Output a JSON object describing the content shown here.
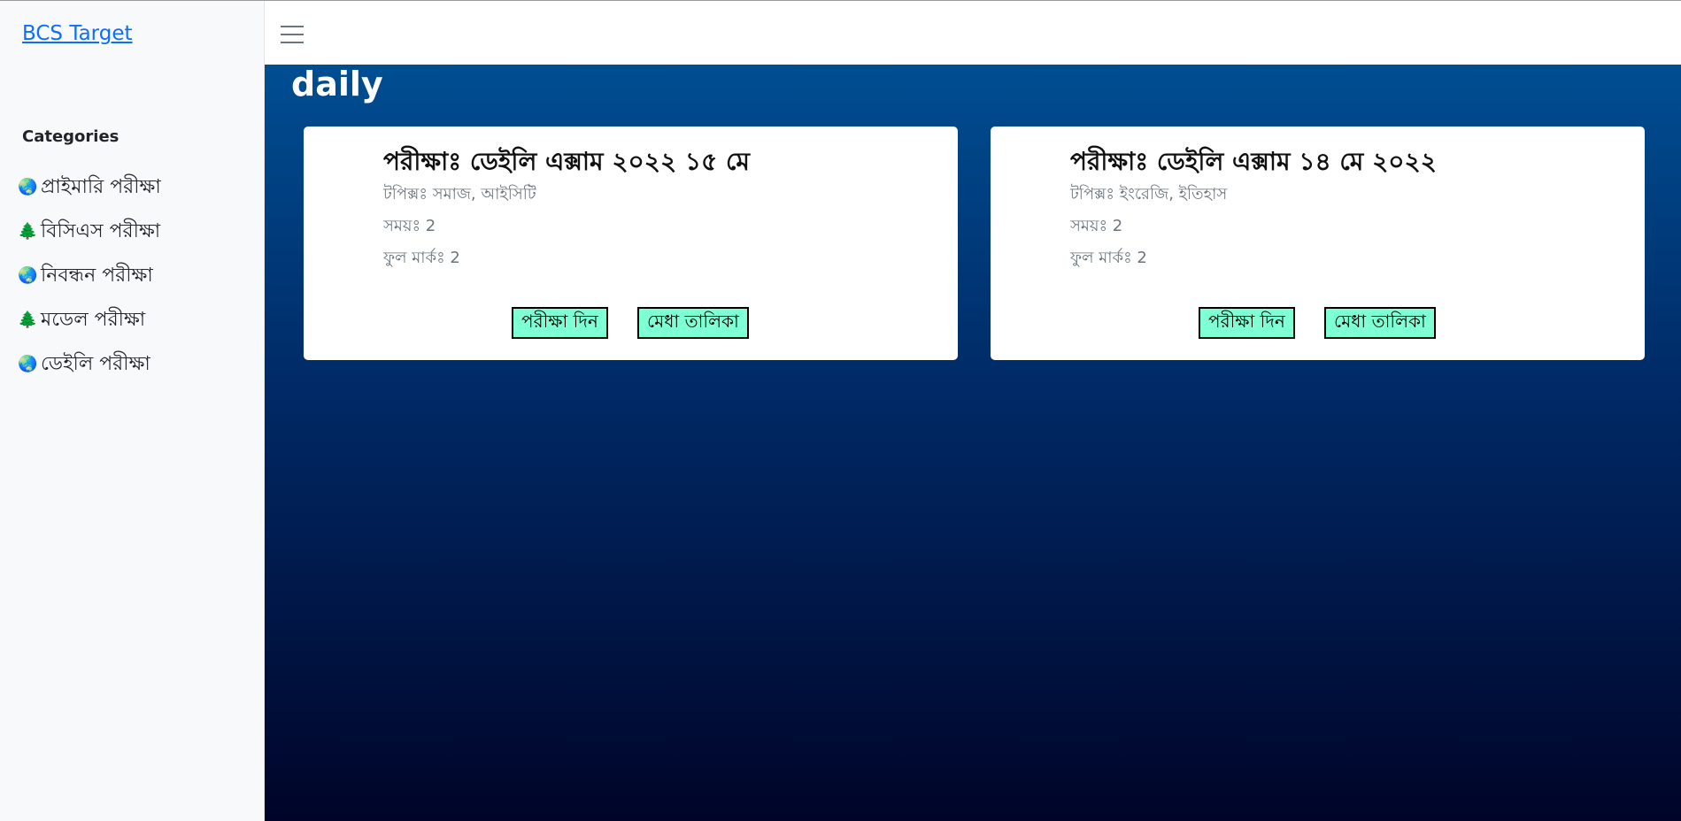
{
  "sidebar": {
    "brand": "BCS Target",
    "categories_title": "Categories",
    "items": [
      {
        "icon": "globe-icon",
        "glyph": "🌏",
        "label": "প্রাইমারি পরীক্ষা"
      },
      {
        "icon": "tree-icon",
        "glyph": "🌲",
        "label": "বিসিএস পরীক্ষা"
      },
      {
        "icon": "globe-icon",
        "glyph": "🌏",
        "label": "নিবন্ধন পরীক্ষা"
      },
      {
        "icon": "tree-icon",
        "glyph": "🌲",
        "label": "মডেল পরীক্ষা"
      },
      {
        "icon": "globe-icon",
        "glyph": "🌏",
        "label": "ডেইলি পরীক্ষা"
      }
    ]
  },
  "header": {
    "menu_icon": "hamburger-icon"
  },
  "main": {
    "title": "daily",
    "cards": [
      {
        "title": "পরীক্ষাঃ ডেইলি এক্সাম ২০২২ ১৫ মে",
        "topics": "টপিক্সঃ সমাজ, আইসিটি",
        "time": "সময়ঃ 2",
        "marks": "ফুল মার্কঃ 2",
        "exam_button": "পরীক্ষা দিন",
        "merit_button": "মেধা তালিকা"
      },
      {
        "title": "পরীক্ষাঃ ডেইলি এক্সাম ১৪ মে ২০২২",
        "topics": "টপিক্সঃ ইংরেজি, ইতিহাস",
        "time": "সময়ঃ 2",
        "marks": "ফুল মার্কঃ 2",
        "exam_button": "পরীক্ষা দিন",
        "merit_button": "মেধা তালিকা"
      }
    ]
  },
  "colors": {
    "brand_link": "#0d6efd",
    "button_bg": "#7fffd4",
    "gradient_top": "#004e92",
    "gradient_bottom": "#000428"
  }
}
